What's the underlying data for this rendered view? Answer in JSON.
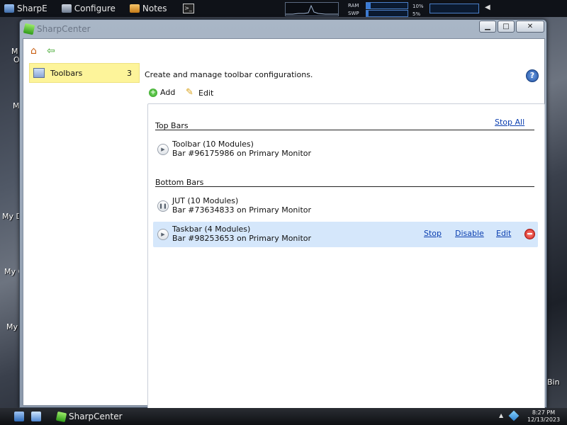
{
  "topbar": {
    "buttons": [
      {
        "label": "SharpE",
        "icon": "sharpe-icon"
      },
      {
        "label": "Configure",
        "icon": "configure-icon"
      },
      {
        "label": "Notes",
        "icon": "notes-icon"
      }
    ],
    "terminal_glyph": ">_",
    "meters": {
      "ram_label": "RAM",
      "ram_value": "10%",
      "ram_level": 0.1,
      "swp_label": "SWP",
      "swp_value": "5%",
      "swp_level": 0.05
    }
  },
  "desktop": {
    "labels": [
      "M",
      "O",
      "M",
      "My D",
      "My C",
      "My",
      "Bin"
    ]
  },
  "window": {
    "title": "SharpCenter",
    "controls": {
      "minimize": "▁",
      "maximize": "□",
      "close": "✕"
    }
  },
  "sidebar": {
    "items": [
      {
        "label": "Toolbars",
        "count": "3"
      }
    ]
  },
  "main": {
    "description": "Create and manage toolbar configurations.",
    "help_glyph": "?",
    "actions": {
      "add": "Add",
      "edit": "Edit"
    },
    "sections": [
      {
        "title": "Top Bars",
        "header_link": "Stop All",
        "bars": [
          {
            "name": "Toolbar (10 Modules)",
            "detail": "Bar #96175986 on Primary Monitor",
            "state": "stopped"
          }
        ]
      },
      {
        "title": "Bottom Bars",
        "bars": [
          {
            "name": "JUT (10 Modules)",
            "detail": "Bar #73634833 on Primary Monitor",
            "state": "paused"
          },
          {
            "name": "Taskbar (4 Modules)",
            "detail": "Bar #98253653 on Primary Monitor",
            "state": "stopped",
            "links": {
              "stop": "Stop",
              "disable": "Disable",
              "edit": "Edit"
            }
          }
        ]
      }
    ]
  },
  "taskbar": {
    "app_label": "SharpCenter",
    "clock_time": "8:27 PM",
    "clock_date": "12/13/2023"
  }
}
